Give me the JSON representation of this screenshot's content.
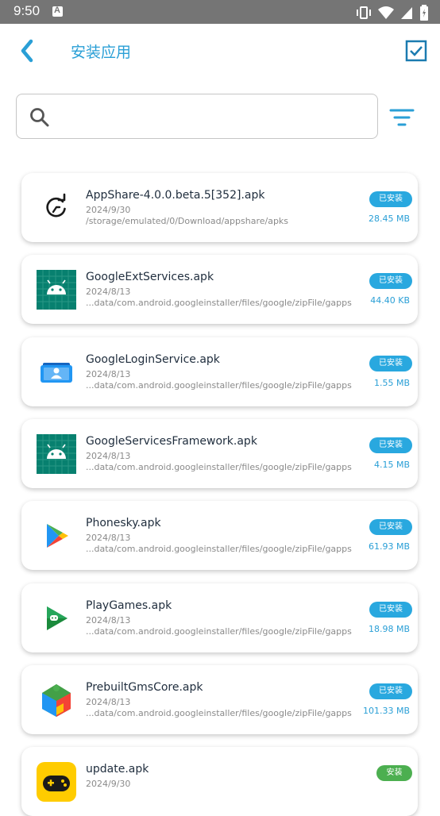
{
  "status_bar": {
    "time": "9:50"
  },
  "header": {
    "title": "安装应用"
  },
  "search": {
    "placeholder": "",
    "value": ""
  },
  "colors": {
    "accent": "#2a9fd6",
    "badge_installed": "#29a8df",
    "badge_install": "#4caf50"
  },
  "files": [
    {
      "name": "AppShare-4.0.0.beta.5[352].apk",
      "date": "2024/9/30",
      "path": " /storage/emulated/0/Download/appshare/apks",
      "status": "已安装",
      "size": "28.45 MB",
      "icon": "refresh-icon"
    },
    {
      "name": "GoogleExtServices.apk",
      "date": "2024/8/13",
      "path": "...data/com.android.googleinstaller/files/google/zipFile/gapps",
      "status": "已安装",
      "size": "44.40 KB",
      "icon": "android-icon"
    },
    {
      "name": "GoogleLoginService.apk",
      "date": "2024/8/13",
      "path": "...data/com.android.googleinstaller/files/google/zipFile/gapps",
      "status": "已安装",
      "size": "1.55 MB",
      "icon": "account-icon"
    },
    {
      "name": "GoogleServicesFramework.apk",
      "date": "2024/8/13",
      "path": "...data/com.android.googleinstaller/files/google/zipFile/gapps",
      "status": "已安装",
      "size": "4.15 MB",
      "icon": "android-icon"
    },
    {
      "name": "Phonesky.apk",
      "date": "2024/8/13",
      "path": "...data/com.android.googleinstaller/files/google/zipFile/gapps",
      "status": "已安装",
      "size": "61.93 MB",
      "icon": "play-store-icon"
    },
    {
      "name": "PlayGames.apk",
      "date": "2024/8/13",
      "path": "...data/com.android.googleinstaller/files/google/zipFile/gapps",
      "status": "已安装",
      "size": "18.98 MB",
      "icon": "play-games-icon"
    },
    {
      "name": "PrebuiltGmsCore.apk",
      "date": "2024/8/13",
      "path": "...data/com.android.googleinstaller/files/google/zipFile/gapps",
      "status": "已安装",
      "size": "101.33 MB",
      "icon": "play-services-icon"
    },
    {
      "name": "update.apk",
      "date": "2024/9/30",
      "path": "",
      "status": "安装",
      "size": "",
      "icon": "gamepad-icon"
    }
  ]
}
